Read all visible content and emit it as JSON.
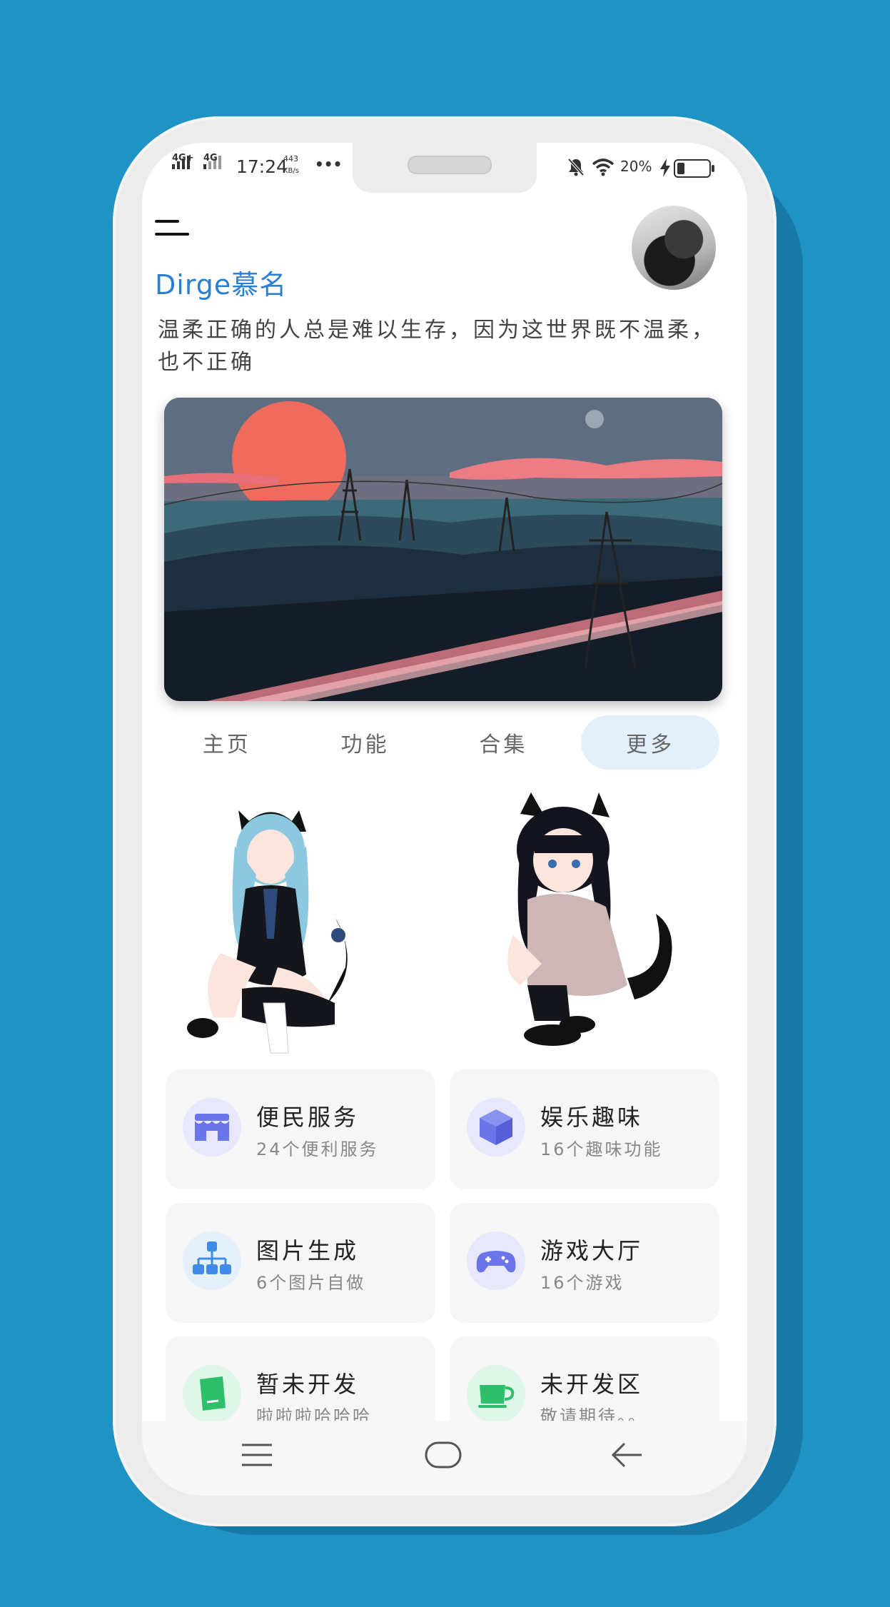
{
  "status_bar": {
    "network1": "4G+",
    "network2": "4G",
    "time": "17:24",
    "speed_value": "443",
    "speed_unit": "KB/s",
    "more": "•••",
    "battery_percent": "20%"
  },
  "profile": {
    "username": "Dirge慕名",
    "motto": "温柔正确的人总是难以生存，因为这世界既不温柔，也不正确"
  },
  "tabs": [
    {
      "label": "主页",
      "active": false
    },
    {
      "label": "功能",
      "active": false
    },
    {
      "label": "合集",
      "active": false
    },
    {
      "label": "更多",
      "active": true
    }
  ],
  "cards": [
    {
      "title": "便民服务",
      "subtitle": "24个便利服务",
      "icon": "store-icon",
      "color": "#6b74e8"
    },
    {
      "title": "娱乐趣味",
      "subtitle": "16个趣味功能",
      "icon": "cube-icon",
      "color": "#6b74e8"
    },
    {
      "title": "图片生成",
      "subtitle": "6个图片自做",
      "icon": "sitemap-icon",
      "color": "#3f8ce8"
    },
    {
      "title": "游戏大厅",
      "subtitle": "16个游戏",
      "icon": "gamepad-icon",
      "color": "#6b74e8"
    },
    {
      "title": "暂未开发",
      "subtitle": "啦啦啦哈哈哈",
      "icon": "book-icon",
      "color": "#2fbf6a"
    },
    {
      "title": "未开发区",
      "subtitle": "敬请期待。。",
      "icon": "cup-icon",
      "color": "#2fbf6a"
    }
  ]
}
